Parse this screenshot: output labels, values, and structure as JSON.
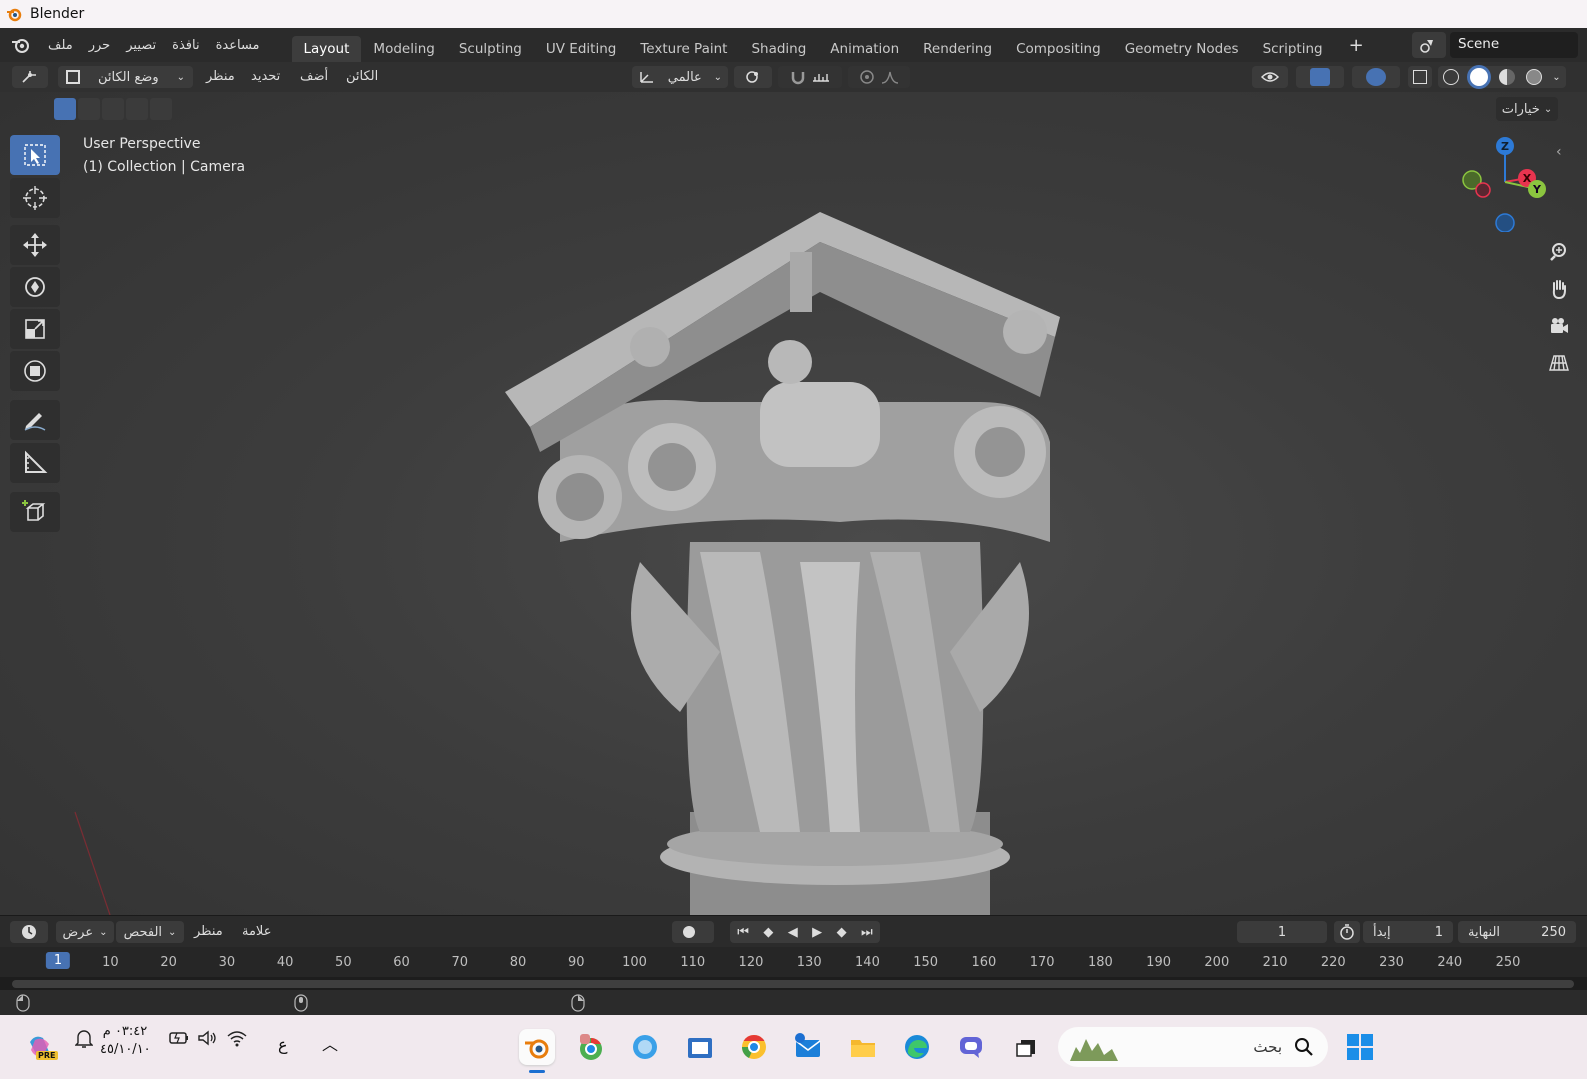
{
  "window": {
    "title": "Blender"
  },
  "menu": [
    "مساعدة",
    "نافذة",
    "تصيير",
    "حرر",
    "ملف"
  ],
  "workspaces": [
    {
      "label": "Layout",
      "active": true
    },
    {
      "label": "Modeling"
    },
    {
      "label": "Sculpting"
    },
    {
      "label": "UV Editing"
    },
    {
      "label": "Texture Paint"
    },
    {
      "label": "Shading"
    },
    {
      "label": "Animation"
    },
    {
      "label": "Rendering"
    },
    {
      "label": "Compositing"
    },
    {
      "label": "Geometry Nodes"
    },
    {
      "label": "Scripting"
    }
  ],
  "add_workspace": "+",
  "scene": {
    "label": "Scene"
  },
  "header": {
    "mode": "وضع الكائن",
    "view": "منظر",
    "select": "تحديد",
    "add": "أضف",
    "object": "الكائن",
    "orientation": "عالمي",
    "options": "خيارات"
  },
  "viewport": {
    "perspective": "User Perspective",
    "collection": "(1) Collection | Camera",
    "gizmo_axes": [
      "Z",
      "X",
      "Y"
    ]
  },
  "timeline": {
    "view": "عرض",
    "inspect": "الفحص",
    "marker_view": "منظر",
    "marker": "علامة",
    "current_frame": "1",
    "start_label": "إبدأ",
    "start": "1",
    "end_label": "النهاية",
    "end": "250",
    "ticks": [
      "1",
      "10",
      "20",
      "30",
      "40",
      "50",
      "60",
      "70",
      "80",
      "90",
      "100",
      "110",
      "120",
      "130",
      "140",
      "150",
      "160",
      "170",
      "180",
      "190",
      "200",
      "210",
      "220",
      "230",
      "240",
      "250"
    ]
  },
  "taskbar": {
    "time": "٠٣:٤٢ م",
    "date": "٤٥/١٠/١٠",
    "language": "ع",
    "search_placeholder": "بحث",
    "copilot_badge": "PRE"
  },
  "colors": {
    "accent": "#4772b3",
    "axis_x": "#e8344f",
    "axis_y": "#8bc53f",
    "axis_z": "#2d7ad6"
  }
}
